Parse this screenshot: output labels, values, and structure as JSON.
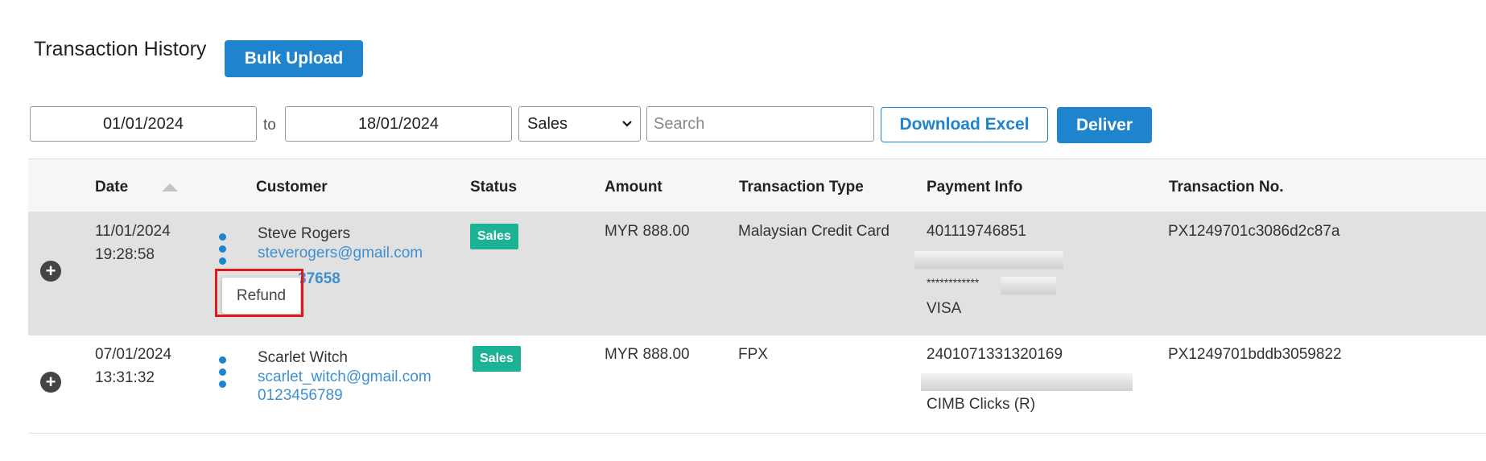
{
  "header": {
    "title": "Transaction History",
    "bulk_upload_label": "Bulk Upload"
  },
  "filters": {
    "date_from": "01/01/2024",
    "to_label": "to",
    "date_to": "18/01/2024",
    "type_selected": "Sales",
    "search_placeholder": "Search",
    "download_label": "Download Excel",
    "deliver_label": "Deliver"
  },
  "table": {
    "columns": [
      "Date",
      "Customer",
      "Status",
      "Amount",
      "Transaction Type",
      "Payment Info",
      "Transaction No."
    ],
    "rows": [
      {
        "date": "11/01/2024",
        "time": "19:28:58",
        "name": "Steve Rogers",
        "email": "steverogers@gmail.com",
        "phone_partial": "37658",
        "status": "Sales",
        "amount": "MYR 888.00",
        "type": "Malaysian Credit Card",
        "payment_ref": "401119746851",
        "card_mask": "************",
        "card_brand": "VISA",
        "txn_no": "PX1249701c3086d2c87a"
      },
      {
        "date": "07/01/2024",
        "time": "13:31:32",
        "name": "Scarlet Witch",
        "email": "scarlet_witch@gmail.com",
        "phone": "0123456789",
        "status": "Sales",
        "amount": "MYR 888.00",
        "type": "FPX",
        "payment_ref": "2401071331320169",
        "bank": "CIMB Clicks (R)",
        "txn_no": "PX1249701bddb3059822"
      }
    ]
  },
  "popover": {
    "refund_label": "Refund"
  },
  "colors": {
    "primary": "#1e84cd",
    "badge": "#1cb394",
    "highlight": "#e0181e"
  }
}
